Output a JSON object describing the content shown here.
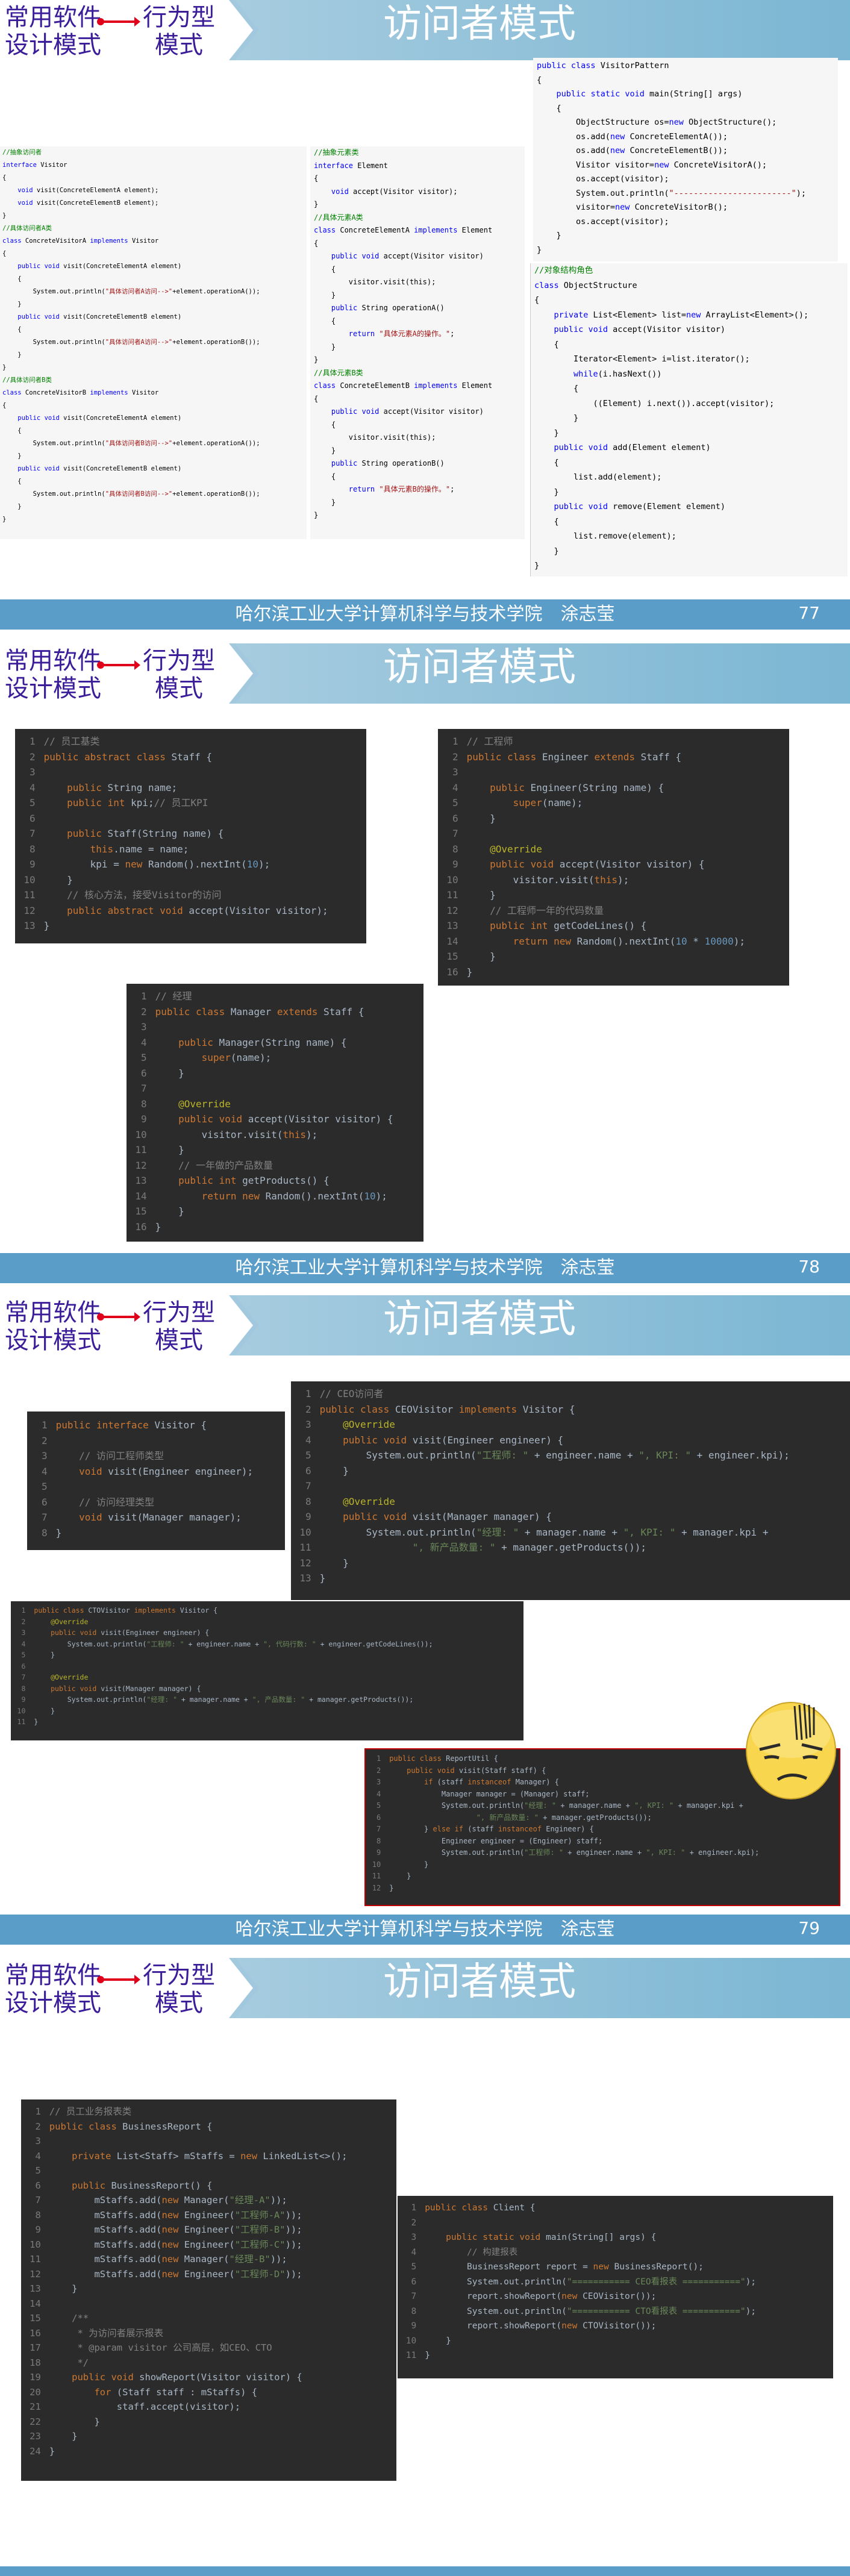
{
  "header": {
    "brand_line1": "常用软件",
    "brand_line2": "设计模式",
    "category_line1": "行为型",
    "category_line2": "模式",
    "title": "访问者模式"
  },
  "footer": {
    "institution": "哈尔滨工业大学计算机科学与技术学院　涂志莹"
  },
  "slides": [
    {
      "page": "77",
      "blocks": {
        "visitor_block": [
          "//抽象访问者",
          "interface Visitor",
          "{",
          "    void visit(ConcreteElementA element);",
          "    void visit(ConcreteElementB element);",
          "}",
          "//具体访问者A类",
          "class ConcreteVisitorA implements Visitor",
          "{",
          "    public void visit(ConcreteElementA element)",
          "    {",
          "        System.out.println(\"具体访问者A访问-->\"+element.operationA());",
          "    }",
          "    public void visit(ConcreteElementB element)",
          "    {",
          "        System.out.println(\"具体访问者A访问-->\"+element.operationB());",
          "    }",
          "}",
          "//具体访问者B类",
          "class ConcreteVisitorB implements Visitor",
          "{",
          "    public void visit(ConcreteElementA element)",
          "    {",
          "        System.out.println(\"具体访问者B访问-->\"+element.operationA());",
          "    }",
          "    public void visit(ConcreteElementB element)",
          "    {",
          "        System.out.println(\"具体访问者B访问-->\"+element.operationB());",
          "    }",
          "}"
        ],
        "element_block": [
          "//抽象元素类",
          "interface Element",
          "{",
          "    void accept(Visitor visitor);",
          "}",
          "//具体元素A类",
          "class ConcreteElementA implements Element",
          "{",
          "    public void accept(Visitor visitor)",
          "    {",
          "        visitor.visit(this);",
          "    }",
          "    public String operationA()",
          "    {",
          "        return \"具体元素A的操作。\";",
          "    }",
          "}",
          "//具体元素B类",
          "class ConcreteElementB implements Element",
          "{",
          "    public void accept(Visitor visitor)",
          "    {",
          "        visitor.visit(this);",
          "    }",
          "    public String operationB()",
          "    {",
          "        return \"具体元素B的操作。\";",
          "    }",
          "}"
        ],
        "main_block": [
          "public class VisitorPattern",
          "{",
          "    public static void main(String[] args)",
          "    {",
          "        ObjectStructure os=new ObjectStructure();",
          "        os.add(new ConcreteElementA());",
          "        os.add(new ConcreteElementB());",
          "        Visitor visitor=new ConcreteVisitorA();",
          "        os.accept(visitor);",
          "        System.out.println(\"------------------------\");",
          "        visitor=new ConcreteVisitorB();",
          "        os.accept(visitor);",
          "    }",
          "}"
        ],
        "structure_block": [
          "//对象结构角色",
          "class ObjectStructure",
          "{",
          "    private List<Element> list=new ArrayList<Element>();",
          "    public void accept(Visitor visitor)",
          "    {",
          "        Iterator<Element> i=list.iterator();",
          "        while(i.hasNext())",
          "        {",
          "            ((Element) i.next()).accept(visitor);",
          "        }",
          "    }",
          "    public void add(Element element)",
          "    {",
          "        list.add(element);",
          "    }",
          "    public void remove(Element element)",
          "    {",
          "        list.remove(element);",
          "    }",
          "}"
        ]
      }
    },
    {
      "page": "78",
      "blocks": {
        "staff_block": [
          "// 员工基类",
          "public abstract class Staff {",
          "",
          "    public String name;",
          "    public int kpi;// 员工KPI",
          "",
          "    public Staff(String name) {",
          "        this.name = name;",
          "        kpi = new Random().nextInt(10);",
          "    }",
          "    // 核心方法，接受Visitor的访问",
          "    public abstract void accept(Visitor visitor);",
          "}"
        ],
        "engineer_block": [
          "// 工程师",
          "public class Engineer extends Staff {",
          "",
          "    public Engineer(String name) {",
          "        super(name);",
          "    }",
          "",
          "    @Override",
          "    public void accept(Visitor visitor) {",
          "        visitor.visit(this);",
          "    }",
          "    // 工程师一年的代码数量",
          "    public int getCodeLines() {",
          "        return new Random().nextInt(10 * 10000);",
          "    }",
          "}"
        ],
        "manager_block": [
          "// 经理",
          "public class Manager extends Staff {",
          "",
          "    public Manager(String name) {",
          "        super(name);",
          "    }",
          "",
          "    @Override",
          "    public void accept(Visitor visitor) {",
          "        visitor.visit(this);",
          "    }",
          "    // 一年做的产品数量",
          "    public int getProducts() {",
          "        return new Random().nextInt(10);",
          "    }",
          "}"
        ]
      }
    },
    {
      "page": "79",
      "blocks": {
        "visitor_iface_block": [
          "public interface Visitor {",
          "",
          "    // 访问工程师类型",
          "    void visit(Engineer engineer);",
          "",
          "    // 访问经理类型",
          "    void visit(Manager manager);",
          "}"
        ],
        "ceo_block": [
          "// CEO访问者",
          "public class CEOVisitor implements Visitor {",
          "    @Override",
          "    public void visit(Engineer engineer) {",
          "        System.out.println(\"工程师: \" + engineer.name + \", KPI: \" + engineer.kpi);",
          "    }",
          "",
          "    @Override",
          "    public void visit(Manager manager) {",
          "        System.out.println(\"经理: \" + manager.name + \", KPI: \" + manager.kpi +",
          "                \", 新产品数量: \" + manager.getProducts());",
          "    }",
          "}"
        ],
        "cto_block": [
          "public class CTOVisitor implements Visitor {",
          "    @Override",
          "    public void visit(Engineer engineer) {",
          "        System.out.println(\"工程师: \" + engineer.name + \", 代码行数: \" + engineer.getCodeLines());",
          "    }",
          "",
          "    @Override",
          "    public void visit(Manager manager) {",
          "        System.out.println(\"经理: \" + manager.name + \", 产品数量: \" + manager.getProducts());",
          "    }",
          "}"
        ],
        "report_util_block": [
          "public class ReportUtil {",
          "    public void visit(Staff staff) {",
          "        if (staff instanceof Manager) {",
          "            Manager manager = (Manager) staff;",
          "            System.out.println(\"经理: \" + manager.name + \", KPI: \" + manager.kpi +",
          "                    \", 新产品数量: \" + manager.getProducts());",
          "        } else if (staff instanceof Engineer) {",
          "            Engineer engineer = (Engineer) staff;",
          "            System.out.println(\"工程师: \" + engineer.name + \", KPI: \" + engineer.kpi);",
          "        }",
          "    }",
          "}"
        ]
      }
    },
    {
      "page": "",
      "blocks": {
        "business_report_block": [
          "// 员工业务报表类",
          "public class BusinessReport {",
          "",
          "    private List<Staff> mStaffs = new LinkedList<>();",
          "",
          "    public BusinessReport() {",
          "        mStaffs.add(new Manager(\"经理-A\"));",
          "        mStaffs.add(new Engineer(\"工程师-A\"));",
          "        mStaffs.add(new Engineer(\"工程师-B\"));",
          "        mStaffs.add(new Engineer(\"工程师-C\"));",
          "        mStaffs.add(new Manager(\"经理-B\"));",
          "        mStaffs.add(new Engineer(\"工程师-D\"));",
          "    }",
          "",
          "    /**",
          "     * 为访问者展示报表",
          "     * @param visitor 公司高层，如CEO、CTO",
          "     */",
          "    public void showReport(Visitor visitor) {",
          "        for (Staff staff : mStaffs) {",
          "            staff.accept(visitor);",
          "        }",
          "    }",
          "}"
        ],
        "client_block": [
          "public class Client {",
          "",
          "    public static void main(String[] args) {",
          "        // 构建报表",
          "        BusinessReport report = new BusinessReport();",
          "        System.out.println(\"=========== CEO看报表 ===========\");",
          "        report.showReport(new CEOVisitor());",
          "        System.out.println(\"=========== CTO看报表 ===========\");",
          "        report.showReport(new CTOVisitor());",
          "    }",
          "}"
        ]
      }
    }
  ],
  "icons": {
    "emoji": "thinking-face-icon"
  },
  "colors": {
    "header_accent": "#7bb6d3",
    "footer_bg": "#5a9dc8",
    "brand_text": "#3b1d9a",
    "code_bg": "#2b2b2b"
  }
}
